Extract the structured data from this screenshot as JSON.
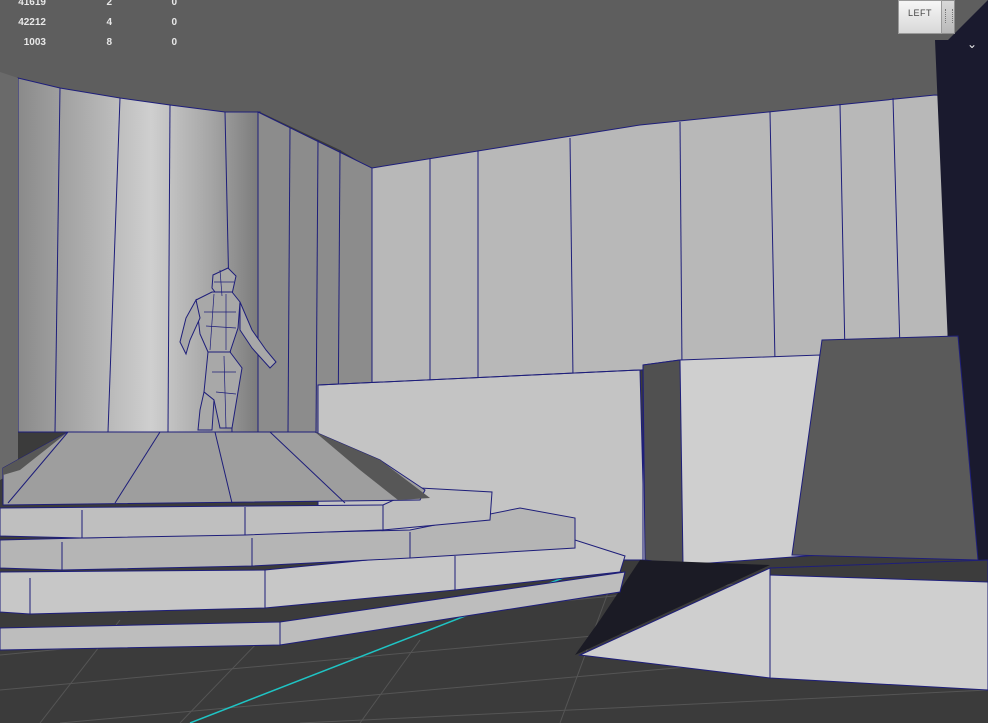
{
  "hud": {
    "rows": [
      {
        "a": "41619",
        "b": "2",
        "c": "0"
      },
      {
        "a": "42212",
        "b": "4",
        "c": "0"
      },
      {
        "a": "1003",
        "b": "8",
        "c": "0"
      }
    ]
  },
  "viewcube": {
    "face_label": "LEFT"
  },
  "menu": {
    "icon": "chevron-down-icon"
  },
  "colors": {
    "wireframe": "#1e1e7a",
    "grid_axis": "#1fc4c4",
    "floor": "#3b3b3b",
    "ceiling": "#5e5e5e"
  }
}
